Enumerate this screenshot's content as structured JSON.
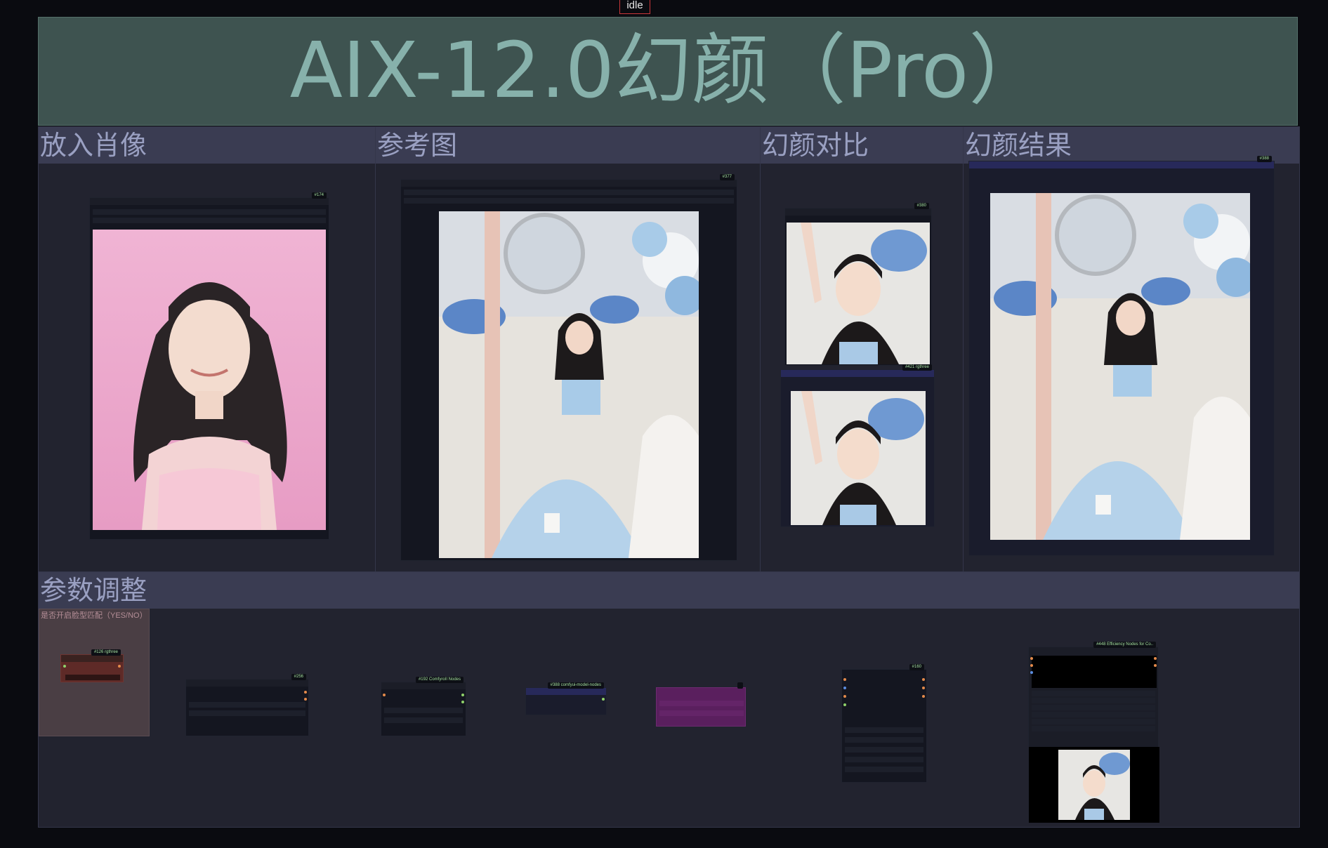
{
  "status": {
    "text": "idle"
  },
  "title": {
    "text": "AIX-12.0幻颜（Pro）"
  },
  "groups": {
    "portrait": {
      "label": "放入肖像",
      "node_tag": "#174"
    },
    "reference": {
      "label": "参考图",
      "node_tag": "#377"
    },
    "compare": {
      "label": "幻颜对比",
      "node_tag_top": "#380",
      "node_tag_bottom": "#421 rgthree"
    },
    "result": {
      "label": "幻颜结果",
      "node_tag": "#388"
    },
    "params": {
      "label": "参数调整",
      "switch_label": "是否开启脸型匹配（YES/NO）"
    }
  },
  "param_nodes": [
    {
      "tag": "#126 rgthree"
    },
    {
      "tag": "#256"
    },
    {
      "tag": "#192 ComfyroII Nodes"
    },
    {
      "tag": "#388 comfyui-model-nodes"
    },
    {
      "tag": ""
    },
    {
      "tag": "#160"
    },
    {
      "tag": "#448 Efficiency Nodes for Co.."
    }
  ],
  "colors": {
    "background": "#0a0b10",
    "title_bg": "#3e5350",
    "title_text": "#87b1ab",
    "group_bg": "#22232f",
    "group_header_bg": "#3a3c52",
    "group_header_text": "#9aa0c2",
    "accent_purple": "#5a1f5e",
    "switch_group_bg": "#4a3e44"
  },
  "icons": [
    "image-placeholder-icon",
    "status-dot-icon"
  ]
}
